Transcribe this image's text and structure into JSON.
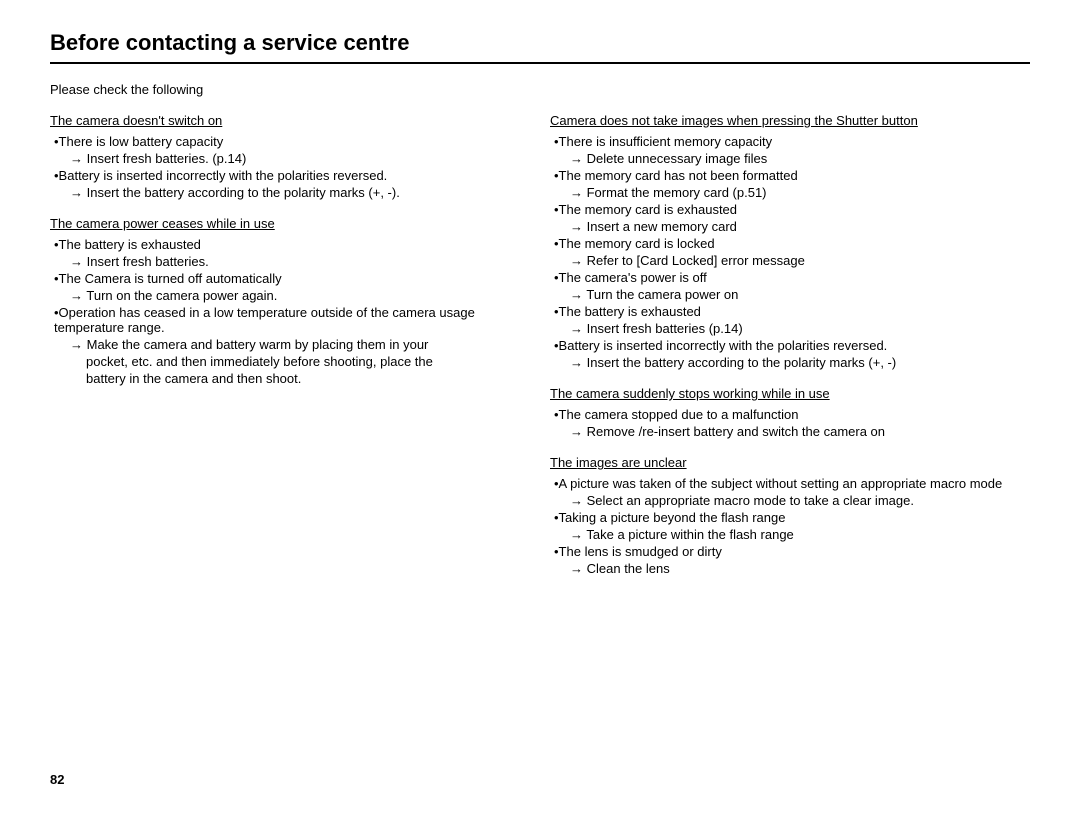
{
  "page": {
    "title": "Before contacting a service centre",
    "page_number": "82",
    "intro": "Please check the following"
  },
  "left_column": {
    "section1": {
      "heading": "The camera doesn't switch on",
      "items": [
        {
          "bullet": "•There is low battery capacity",
          "arrow": "→  Insert fresh batteries. (p.14)"
        },
        {
          "bullet": "•Battery is inserted incorrectly with the polarities reversed.",
          "arrow": "→ Insert the battery according to the polarity marks (+, -)."
        }
      ]
    },
    "section2": {
      "heading": "The camera power ceases while in use",
      "items": [
        {
          "bullet": "•The battery is exhausted",
          "arrow": "→ Insert fresh batteries."
        },
        {
          "bullet": "•The Camera is turned off automatically",
          "arrow": "→ Turn on the camera power again."
        },
        {
          "bullet": "•Operation has ceased in a low temperature outside of the camera usage temperature range.",
          "arrow": "→ Make the camera and battery warm by placing them in your pocket, etc. and then immediately before shooting, place the battery in the camera and then shoot."
        }
      ]
    }
  },
  "right_column": {
    "section1": {
      "heading": "Camera does not take images when pressing the Shutter button",
      "items": [
        {
          "bullet": "•There is insufficient memory capacity",
          "arrow": "→ Delete unnecessary image files"
        },
        {
          "bullet": "•The memory card has not been formatted",
          "arrow": "→ Format the memory card (p.51)"
        },
        {
          "bullet": "•The memory card is exhausted",
          "arrow": "→ Insert a new memory card"
        },
        {
          "bullet": "•The memory card is locked",
          "arrow": "→ Refer to [Card Locked] error message"
        },
        {
          "bullet": "•The camera's power is off",
          "arrow": "→ Turn the camera power on"
        },
        {
          "bullet": "•The battery is exhausted",
          "arrow": "→ Insert fresh batteries (p.14)"
        },
        {
          "bullet": "•Battery is inserted incorrectly with the polarities reversed.",
          "arrow": "→ Insert the battery according to the polarity marks (+, -)"
        }
      ]
    },
    "section2": {
      "heading": "The camera suddenly stops working while in use",
      "items": [
        {
          "bullet": "•The camera stopped due to a malfunction",
          "arrow": "→ Remove /re-insert battery and switch the camera on"
        }
      ]
    },
    "section3": {
      "heading": "The images are unclear",
      "items": [
        {
          "bullet": "•A picture was taken of the subject without setting an appropriate macro mode",
          "arrow": "→ Select an appropriate macro mode to take a clear image."
        },
        {
          "bullet": "•Taking a picture beyond the flash range",
          "arrow": "→ Take a picture within the flash range"
        },
        {
          "bullet": "•The lens is smudged or dirty",
          "arrow": "→ Clean the lens"
        }
      ]
    }
  }
}
